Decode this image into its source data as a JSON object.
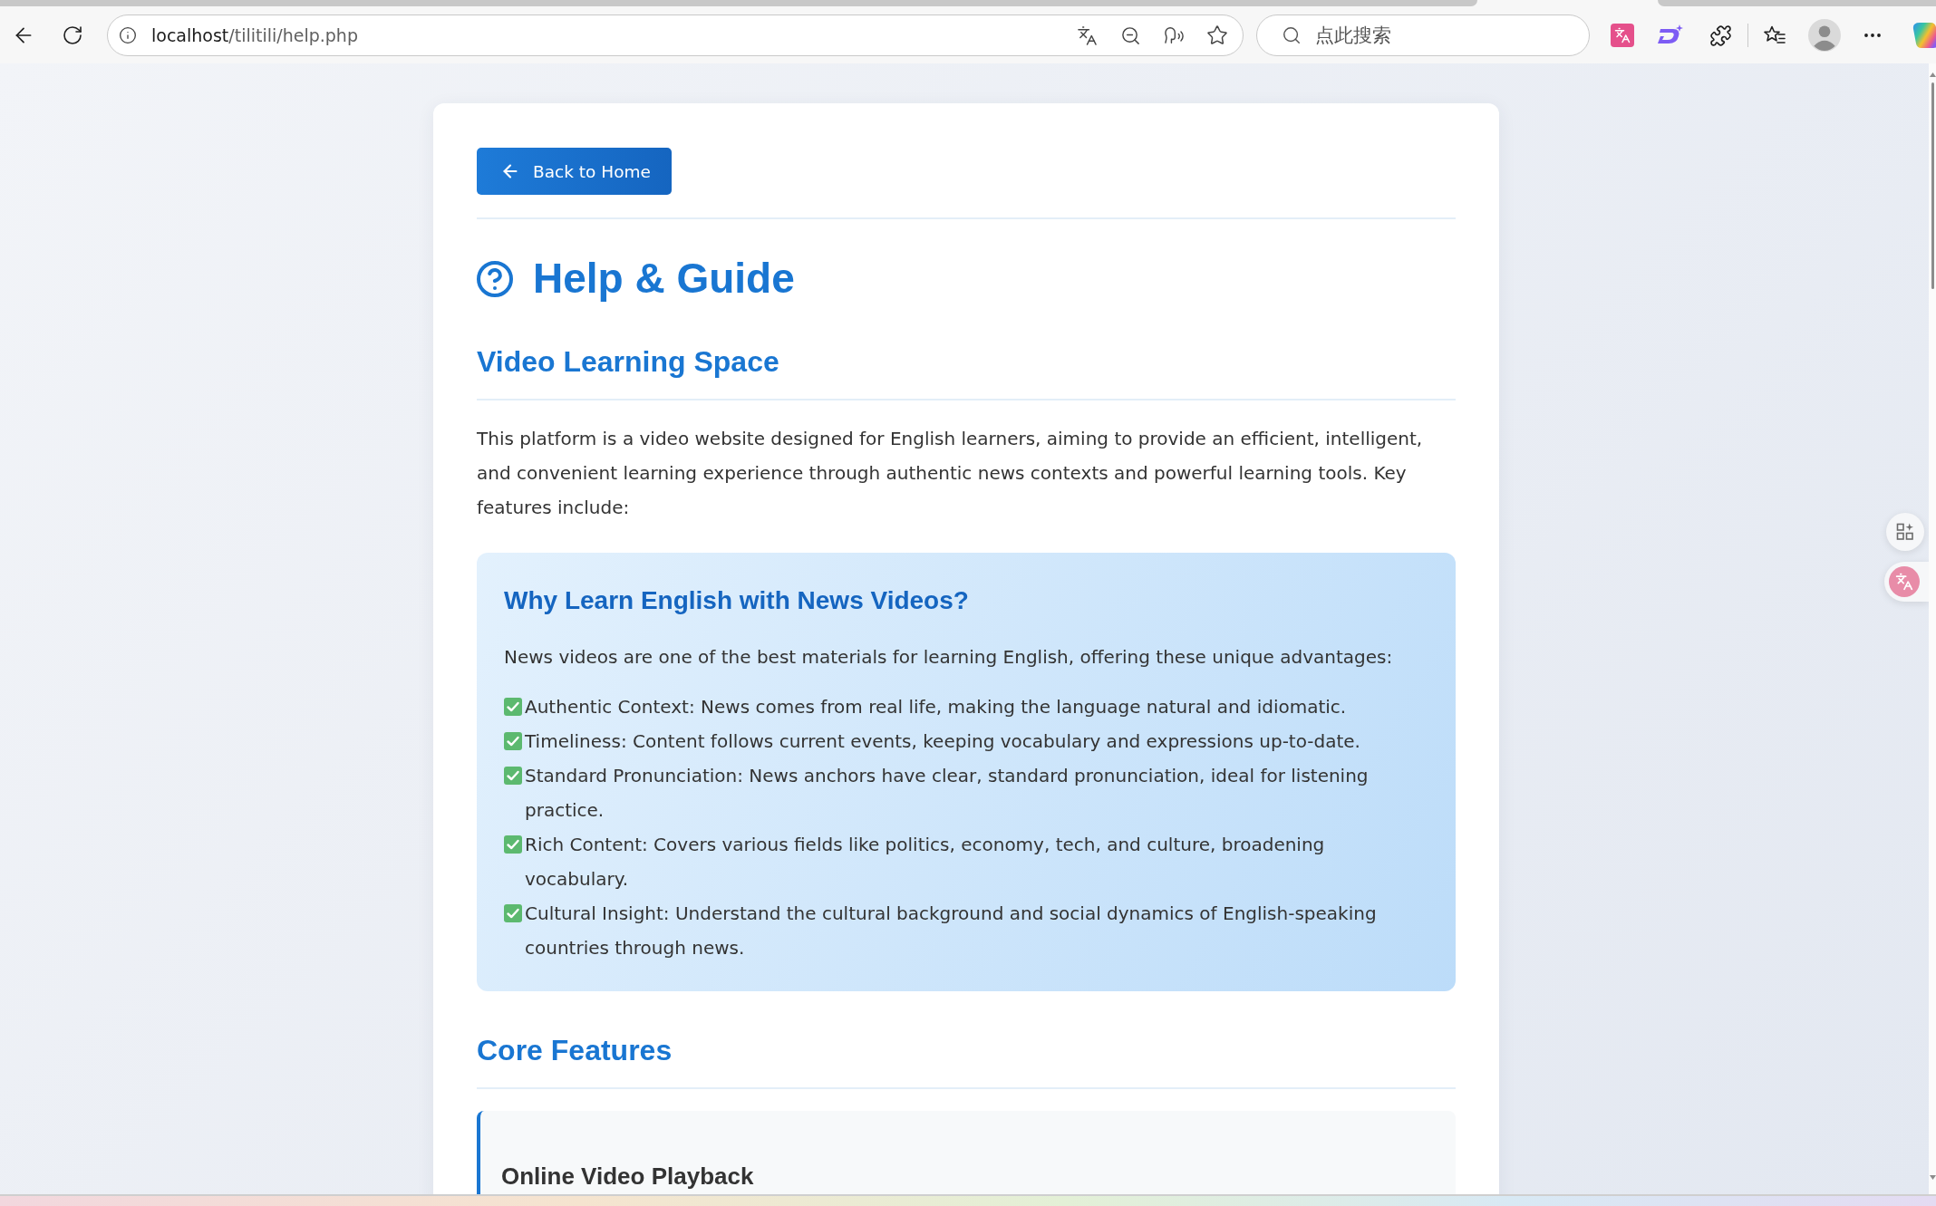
{
  "browser": {
    "url": {
      "host": "localhost",
      "path": "/tilitili/help.php"
    },
    "search": {
      "placeholder": "点此搜索"
    }
  },
  "back_button": {
    "label": "Back to Home"
  },
  "page_title": "Help & Guide",
  "intro": {
    "heading": "Video Learning Space",
    "paragraph": "This platform is a video website designed for English learners, aiming to provide an efficient, intelligent, and convenient learning experience through authentic news contexts and powerful learning tools. Key features include:"
  },
  "callout": {
    "title": "Why Learn English with News Videos?",
    "lead": "News videos are one of the best materials for learning English, offering these unique advantages:",
    "points": [
      "Authentic Context: News comes from real life, making the language natural and idiomatic.",
      "Timeliness: Content follows current events, keeping vocabulary and expressions up-to-date.",
      "Standard Pronunciation: News anchors have clear, standard pronunciation, ideal for listening practice.",
      "Rich Content: Covers various fields like politics, economy, tech, and culture, broadening vocabulary.",
      "Cultural Insight: Understand the cultural background and social dynamics of English-speaking countries through news."
    ]
  },
  "features": {
    "heading": "Core Features",
    "items": [
      {
        "title": "Online Video Playback"
      }
    ]
  }
}
